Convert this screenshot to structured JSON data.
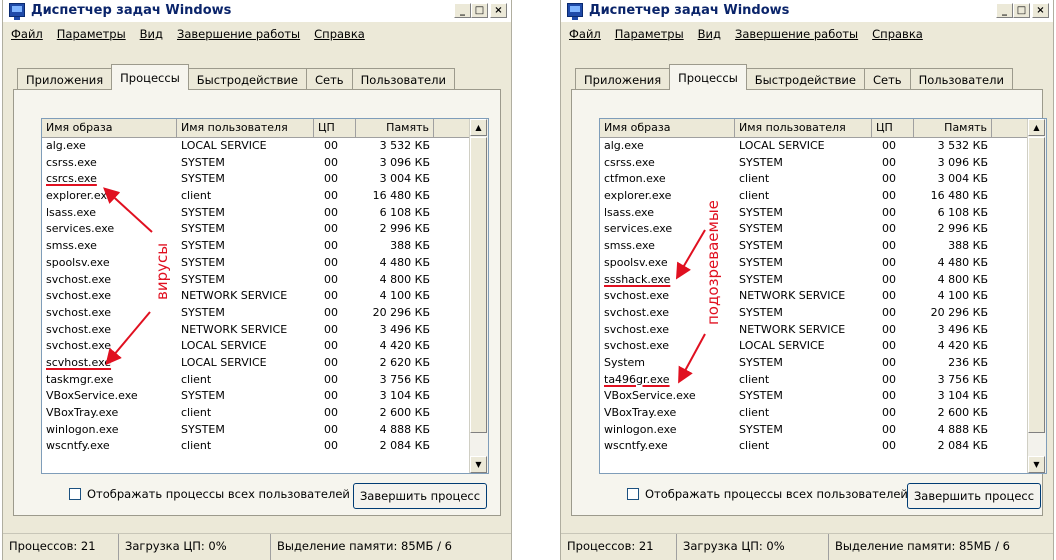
{
  "windows": [
    {
      "title": "Диспетчер задач Windows",
      "menu": [
        "Файл",
        "Параметры",
        "Вид",
        "Завершение работы",
        "Справка"
      ],
      "tabs": [
        "Приложения",
        "Процессы",
        "Быстродействие",
        "Сеть",
        "Пользователи"
      ],
      "active_tab": "Процессы",
      "columns": [
        "Имя образа",
        "Имя пользователя",
        "ЦП",
        "Память"
      ],
      "rows": [
        {
          "name": "alg.exe",
          "user": "LOCAL SERVICE",
          "cpu": "00",
          "mem": "3 532 КБ"
        },
        {
          "name": "csrss.exe",
          "user": "SYSTEM",
          "cpu": "00",
          "mem": "3 096 КБ"
        },
        {
          "name": "csrcs.exe",
          "user": "SYSTEM",
          "cpu": "00",
          "mem": "3 004 КБ",
          "marked": true
        },
        {
          "name": "explorer.exe",
          "user": "client",
          "cpu": "00",
          "mem": "16 480 КБ"
        },
        {
          "name": "lsass.exe",
          "user": "SYSTEM",
          "cpu": "00",
          "mem": "6 108 КБ"
        },
        {
          "name": "services.exe",
          "user": "SYSTEM",
          "cpu": "00",
          "mem": "2 996 КБ"
        },
        {
          "name": "smss.exe",
          "user": "SYSTEM",
          "cpu": "00",
          "mem": "388 КБ"
        },
        {
          "name": "spoolsv.exe",
          "user": "SYSTEM",
          "cpu": "00",
          "mem": "4 480 КБ"
        },
        {
          "name": "svchost.exe",
          "user": "SYSTEM",
          "cpu": "00",
          "mem": "4 800 КБ"
        },
        {
          "name": "svchost.exe",
          "user": "NETWORK SERVICE",
          "cpu": "00",
          "mem": "4 100 КБ"
        },
        {
          "name": "svchost.exe",
          "user": "SYSTEM",
          "cpu": "00",
          "mem": "20 296 КБ"
        },
        {
          "name": "svchost.exe",
          "user": "NETWORK SERVICE",
          "cpu": "00",
          "mem": "3 496 КБ"
        },
        {
          "name": "svchost.exe",
          "user": "LOCAL SERVICE",
          "cpu": "00",
          "mem": "4 420 КБ"
        },
        {
          "name": "scvhost.exe",
          "user": "LOCAL SERVICE",
          "cpu": "00",
          "mem": "2 620 КБ",
          "marked": true
        },
        {
          "name": "taskmgr.exe",
          "user": "client",
          "cpu": "00",
          "mem": "3 756 КБ"
        },
        {
          "name": "VBoxService.exe",
          "user": "SYSTEM",
          "cpu": "00",
          "mem": "3 104 КБ"
        },
        {
          "name": "VBoxTray.exe",
          "user": "client",
          "cpu": "00",
          "mem": "2 600 КБ"
        },
        {
          "name": "winlogon.exe",
          "user": "SYSTEM",
          "cpu": "00",
          "mem": "4 888 КБ"
        },
        {
          "name": "wscntfy.exe",
          "user": "client",
          "cpu": "00",
          "mem": "2 084 КБ"
        }
      ],
      "show_all_label": "Отображать процессы всех пользователей",
      "end_process_label": "Завершить процесс",
      "status": [
        "Процессов: 21",
        "Загрузка ЦП: 0%",
        "Выделение памяти: 85МБ / 6"
      ],
      "annotation": "вирусы"
    },
    {
      "title": "Диспетчер задач Windows",
      "menu": [
        "Файл",
        "Параметры",
        "Вид",
        "Завершение работы",
        "Справка"
      ],
      "tabs": [
        "Приложения",
        "Процессы",
        "Быстродействие",
        "Сеть",
        "Пользователи"
      ],
      "active_tab": "Процессы",
      "columns": [
        "Имя образа",
        "Имя пользователя",
        "ЦП",
        "Память"
      ],
      "rows": [
        {
          "name": "alg.exe",
          "user": "LOCAL SERVICE",
          "cpu": "00",
          "mem": "3 532 КБ"
        },
        {
          "name": "csrss.exe",
          "user": "SYSTEM",
          "cpu": "00",
          "mem": "3 096 КБ"
        },
        {
          "name": "ctfmon.exe",
          "user": "client",
          "cpu": "00",
          "mem": "3 004 КБ"
        },
        {
          "name": "explorer.exe",
          "user": "client",
          "cpu": "00",
          "mem": "16 480 КБ"
        },
        {
          "name": "lsass.exe",
          "user": "SYSTEM",
          "cpu": "00",
          "mem": "6 108 КБ"
        },
        {
          "name": "services.exe",
          "user": "SYSTEM",
          "cpu": "00",
          "mem": "2 996 КБ"
        },
        {
          "name": "smss.exe",
          "user": "SYSTEM",
          "cpu": "00",
          "mem": "388 КБ"
        },
        {
          "name": "spoolsv.exe",
          "user": "SYSTEM",
          "cpu": "00",
          "mem": "4 480 КБ"
        },
        {
          "name": "ssshack.exe",
          "user": "SYSTEM",
          "cpu": "00",
          "mem": "4 800 КБ",
          "marked": true
        },
        {
          "name": "svchost.exe",
          "user": "NETWORK SERVICE",
          "cpu": "00",
          "mem": "4 100 КБ"
        },
        {
          "name": "svchost.exe",
          "user": "SYSTEM",
          "cpu": "00",
          "mem": "20 296 КБ"
        },
        {
          "name": "svchost.exe",
          "user": "NETWORK SERVICE",
          "cpu": "00",
          "mem": "3 496 КБ"
        },
        {
          "name": "svchost.exe",
          "user": "LOCAL SERVICE",
          "cpu": "00",
          "mem": "4 420 КБ"
        },
        {
          "name": "System",
          "user": "SYSTEM",
          "cpu": "00",
          "mem": "236 КБ"
        },
        {
          "name": "ta496gr.exe",
          "user": "client",
          "cpu": "00",
          "mem": "3 756 КБ",
          "marked": true
        },
        {
          "name": "VBoxService.exe",
          "user": "SYSTEM",
          "cpu": "00",
          "mem": "3 104 КБ"
        },
        {
          "name": "VBoxTray.exe",
          "user": "client",
          "cpu": "00",
          "mem": "2 600 КБ"
        },
        {
          "name": "winlogon.exe",
          "user": "SYSTEM",
          "cpu": "00",
          "mem": "4 888 КБ"
        },
        {
          "name": "wscntfy.exe",
          "user": "client",
          "cpu": "00",
          "mem": "2 084 КБ"
        }
      ],
      "show_all_label": "Отображать процессы всех пользователей",
      "end_process_label": "Завершить процесс",
      "status": [
        "Процессов: 21",
        "Загрузка ЦП: 0%",
        "Выделение памяти: 85МБ / 6"
      ],
      "annotation": "подозреваемые"
    }
  ],
  "colors": {
    "annotation_red": "#e01020",
    "title_blue": "#0a246a"
  }
}
